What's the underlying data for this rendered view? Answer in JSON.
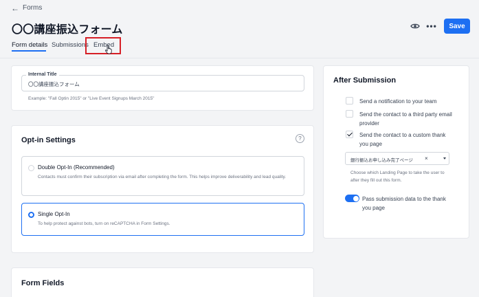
{
  "header": {
    "back_label": "Forms",
    "title": "〇〇講座振込フォーム",
    "save_label": "Save"
  },
  "tabs": [
    {
      "label": "Form details"
    },
    {
      "label": "Submissions"
    },
    {
      "label": "Embed"
    }
  ],
  "internal_title": {
    "legend": "Internal Title",
    "value": "〇〇講座振込フォーム",
    "example": "Example: \"Fall Optin 2015\" or \"Live Event Signups March 2015\""
  },
  "optin": {
    "title": "Opt-in Settings",
    "help_glyph": "?",
    "options": [
      {
        "title": "Double Opt-In (Recommended)",
        "desc": "Contacts must confirm their subscription via email after completing the form. This helps improve deliverability and lead quality.",
        "selected": false
      },
      {
        "title": "Single Opt-In",
        "desc": "To help protect against bots, turn on reCAPTCHA in Form Settings.",
        "selected": true
      }
    ]
  },
  "form_fields": {
    "title": "Form Fields"
  },
  "after_submission": {
    "title": "After Submission",
    "checks": [
      {
        "label": "Send a notification to your team",
        "checked": false
      },
      {
        "label": "Send the contact to a third party email provider",
        "checked": false
      },
      {
        "label": "Send the contact to a custom thank you page",
        "checked": true
      }
    ],
    "landing_page_value": "銀行振込お申し込み完了ページ",
    "clear_glyph": "×",
    "landing_help": "Choose which Landing Page to take the user to after they fill out this form.",
    "toggle_label": "Pass submission data to the thank you page",
    "toggle_on": true
  },
  "icons": {
    "back": "arrow-left-icon",
    "preview": "eye-icon",
    "more": "more-dots-icon",
    "help": "question-circle-icon",
    "cursor": "hand-pointer-icon"
  },
  "colors": {
    "accent": "#1d6ff2",
    "highlight": "#d61f26"
  }
}
